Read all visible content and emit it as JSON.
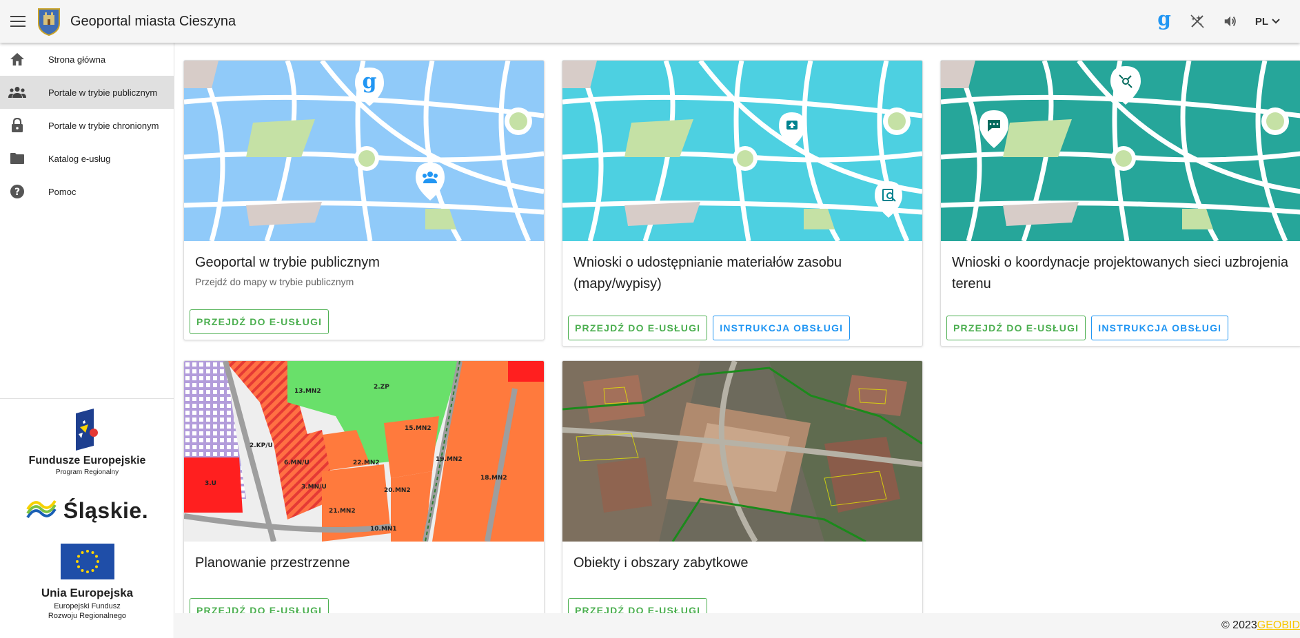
{
  "header": {
    "title": "Geoportal miasta Cieszyna",
    "lang": "PL"
  },
  "sidebar": {
    "items": [
      {
        "label": "Strona główna",
        "icon": "home-icon"
      },
      {
        "label": "Portale w trybie publicznym",
        "icon": "group-icon"
      },
      {
        "label": "Portale w trybie chronionym",
        "icon": "lock-icon"
      },
      {
        "label": "Katalog e-usług",
        "icon": "folder-icon"
      },
      {
        "label": "Pomoc",
        "icon": "help-icon"
      }
    ],
    "active_index": 1
  },
  "logos": {
    "fe_title": "Fundusze Europejskie",
    "fe_sub": "Program Regionalny",
    "slaskie": "Śląskie.",
    "eu_title": "Unia Europejska",
    "eu_sub1": "Europejski Fundusz",
    "eu_sub2": "Rozwoju Regionalnego"
  },
  "cards": [
    {
      "title": "Geoportal w trybie publicznym",
      "subtitle": "Przejdź do mapy w trybie publicznym",
      "btn_go": "PRZEJDŹ DO E-USŁUGI"
    },
    {
      "title": "Wnioski o udostępnianie materiałów zasobu (mapy/wypisy)",
      "btn_go": "PRZEJDŹ DO E-USŁUGI",
      "btn_help": "INSTRUKCJA OBSŁUGI"
    },
    {
      "title": "Wnioski o koordynacje projektowanych sieci uzbrojenia terenu",
      "btn_go": "PRZEJDŹ DO E-USŁUGI",
      "btn_help": "INSTRUKCJA OBSŁUGI"
    },
    {
      "title": "Planowanie przestrzenne",
      "btn_go": "PRZEJDŹ DO E-USŁUGI"
    },
    {
      "title": "Obiekty i obszary zabytkowe",
      "btn_go": "PRZEJDŹ DO E-USŁUGI"
    }
  ],
  "plan_labels": [
    "13.MN2",
    "2.ZP",
    "15.MN2",
    "22.MN2",
    "19.MN2",
    "18.MN2",
    "20.MN2",
    "21.MN2",
    "10.MN1",
    "6.MN/U",
    "3.MN/U",
    "2.KP/U",
    "3.U"
  ],
  "footer": {
    "copyright": "© 2023 ",
    "brand": "GEOBID"
  },
  "colors": {
    "accent_green": "#4caf50",
    "accent_blue": "#2196f3",
    "brand_yellow": "#f7c600",
    "map_blue": "#90caf9",
    "map_cyan": "#4dd0e1",
    "map_teal": "#26a69a"
  }
}
